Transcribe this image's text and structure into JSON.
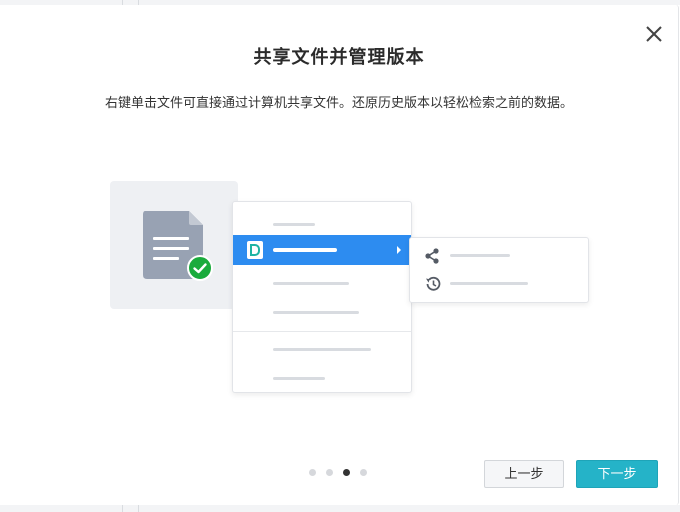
{
  "dialog": {
    "title": "共享文件并管理版本",
    "subtitle": "右键单击文件可直接通过计算机共享文件。还原历史版本以轻松检索之前的数据。",
    "close_icon": "close-icon"
  },
  "illustration": {
    "file_icon": "document-icon",
    "badge_icon": "check-circle-icon",
    "highlight_color": "#2d8cf0",
    "submenu_icons": [
      "share-icon",
      "history-icon"
    ]
  },
  "pager": {
    "total": 4,
    "current": 3
  },
  "buttons": {
    "prev_label": "上一步",
    "next_label": "下一步"
  },
  "colors": {
    "accent": "#25b3c8",
    "check": "#1aab3c"
  }
}
